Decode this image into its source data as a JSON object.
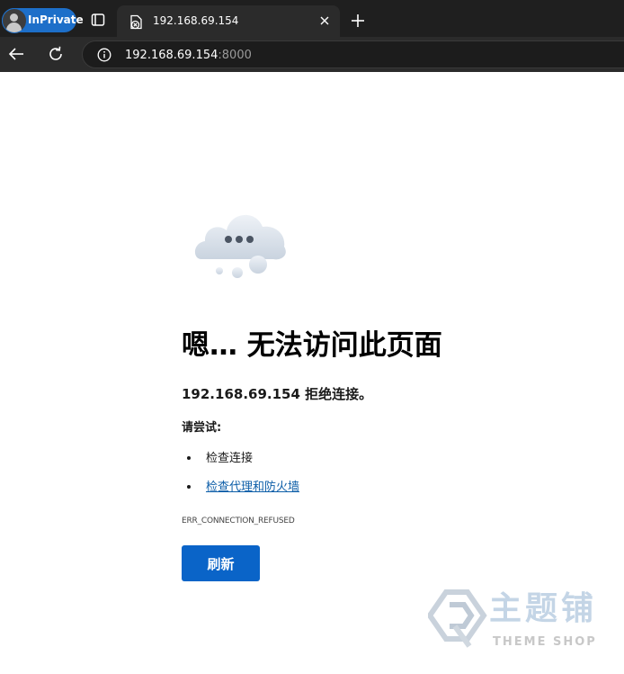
{
  "browser": {
    "profile_label": "InPrivate",
    "tab_title": "192.168.69.154",
    "address": {
      "host": "192.168.69.154",
      "port": ":8000"
    }
  },
  "error_page": {
    "heading": "嗯… 无法访问此页面",
    "subtitle": "192.168.69.154 拒绝连接。",
    "try_label": "请尝试:",
    "suggestions": [
      "检查连接",
      "检查代理和防火墙"
    ],
    "error_code": "ERR_CONNECTION_REFUSED",
    "refresh_label": "刷新"
  },
  "watermark": {
    "chinese": "主题铺",
    "english": "THEME SHOP"
  },
  "icons": {
    "tab_actions": "tab-actions-icon",
    "favicon": "broken-page-icon",
    "close": "close-icon",
    "new_tab": "plus-icon",
    "back": "back-arrow-icon",
    "reload": "reload-icon",
    "info": "info-icon",
    "illustration": "cloud-thinking-icon"
  },
  "colors": {
    "accent": "#0a64c8",
    "link": "#0d5ea8",
    "inprivate": "#1d6fc9"
  }
}
